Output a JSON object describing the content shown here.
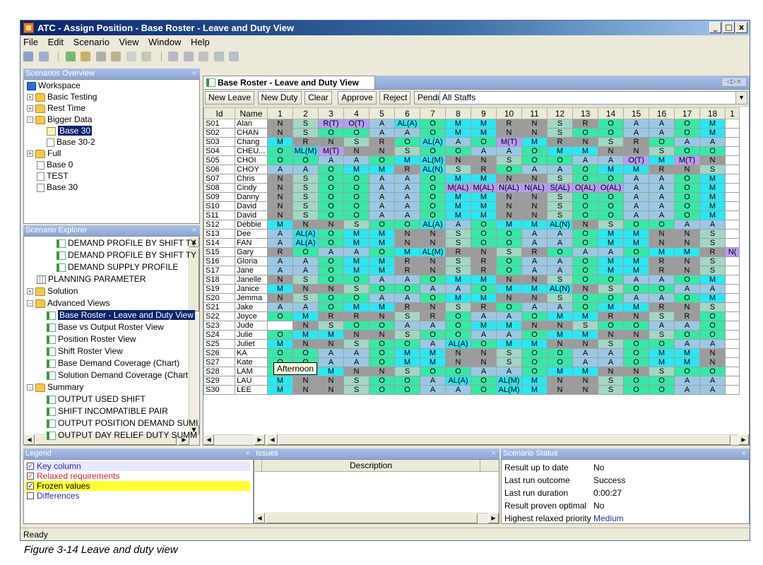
{
  "window": {
    "title": "ATC - Assign Position - Base Roster - Leave and Duty View",
    "controls": [
      "_",
      "□",
      "x"
    ]
  },
  "menu": [
    "File",
    "Edit",
    "Scenario",
    "View",
    "Window",
    "Help"
  ],
  "scenarios_overview": {
    "title": "Scenarios Overview",
    "tree": [
      {
        "label": "Workspace",
        "icon": "workspace-icon",
        "level": 0,
        "toggle": ""
      },
      {
        "label": "Basic Testing",
        "icon": "folder-icon",
        "level": 0,
        "toggle": "+"
      },
      {
        "label": "Rest Time",
        "icon": "folder-icon",
        "level": 0,
        "toggle": "+"
      },
      {
        "label": "Bigger Data",
        "icon": "folder-icon",
        "level": 0,
        "toggle": "-"
      },
      {
        "label": "Base 30",
        "icon": "scenario-icon",
        "level": 2,
        "toggle": "",
        "selected": true
      },
      {
        "label": "Base 30-2",
        "icon": "page-icon",
        "level": 2,
        "toggle": ""
      },
      {
        "label": "Full",
        "icon": "folder-icon",
        "level": 0,
        "toggle": "+"
      },
      {
        "label": "Base 0",
        "icon": "page-icon",
        "level": 1,
        "toggle": ""
      },
      {
        "label": "TEST",
        "icon": "page-icon",
        "level": 1,
        "toggle": ""
      },
      {
        "label": "Base 30",
        "icon": "page-icon",
        "level": 1,
        "toggle": ""
      }
    ]
  },
  "scenario_explorer": {
    "title": "Scenario Explorer",
    "tree": [
      {
        "label": "DEMAND PROFILE BY SHIFT TY",
        "icon": "view-icon",
        "level": 3,
        "toggle": ""
      },
      {
        "label": "DEMAND PROFILE BY SHIFT TY",
        "icon": "view-icon",
        "level": 3,
        "toggle": ""
      },
      {
        "label": "DEMAND SUPPLY PROFILE",
        "icon": "view-icon",
        "level": 3,
        "toggle": ""
      },
      {
        "label": "PLANNING PARAMETER",
        "icon": "table-icon",
        "level": 1,
        "toggle": ""
      },
      {
        "label": "Solution",
        "icon": "folder-icon",
        "level": 0,
        "toggle": "+"
      },
      {
        "label": "Advanced Views",
        "icon": "folder-icon",
        "level": 0,
        "toggle": "-"
      },
      {
        "label": "Base Roster - Leave and Duty View",
        "icon": "view-icon",
        "level": 2,
        "toggle": "",
        "selected": true
      },
      {
        "label": "Base vs Output Roster View",
        "icon": "view-icon",
        "level": 2,
        "toggle": ""
      },
      {
        "label": "Position Roster View",
        "icon": "view-icon",
        "level": 2,
        "toggle": ""
      },
      {
        "label": "Shift Roster View",
        "icon": "view-icon",
        "level": 2,
        "toggle": ""
      },
      {
        "label": "Base Demand Coverage (Chart)",
        "icon": "view-icon",
        "level": 2,
        "toggle": ""
      },
      {
        "label": "Solution Demand Coverage (Chart",
        "icon": "view-icon",
        "level": 2,
        "toggle": ""
      },
      {
        "label": "Summary",
        "icon": "folder-icon",
        "level": 0,
        "toggle": "-"
      },
      {
        "label": "OUTPUT USED SHIFT",
        "icon": "view-icon",
        "level": 2,
        "toggle": ""
      },
      {
        "label": "SHIFT INCOMPATIBLE PAIR",
        "icon": "view-icon",
        "level": 2,
        "toggle": ""
      },
      {
        "label": "OUTPUT POSITION DEMAND SUMI",
        "icon": "view-icon",
        "level": 2,
        "toggle": ""
      },
      {
        "label": "OUTPUT DAY RELIEF DUTY SUMM",
        "icon": "view-icon",
        "level": 2,
        "toggle": ""
      }
    ]
  },
  "editor": {
    "tab_title": "Base Roster - Leave and Duty View",
    "buttons": [
      "New Leave",
      "New Duty",
      "Clear",
      "Approve",
      "Reject",
      "Pending"
    ],
    "staff_filter": "All Staffs",
    "col_id": "Id",
    "col_name": "Name",
    "day_headers": [
      "1",
      "2",
      "3",
      "4",
      "5",
      "6",
      "7",
      "8",
      "9",
      "10",
      "11",
      "12",
      "13",
      "14",
      "15",
      "16",
      "17",
      "18",
      "1"
    ],
    "rows": [
      {
        "id": "S01",
        "name": "Alan",
        "cells": [
          "N",
          "S",
          "R(T)",
          "O(T)",
          "A",
          "AL(A)",
          "O",
          "M",
          "M",
          "R",
          "N",
          "S",
          "R",
          "O",
          "A",
          "A",
          "O",
          "M",
          ""
        ]
      },
      {
        "id": "S02",
        "name": "CHAN",
        "cells": [
          "N",
          "S",
          "O",
          "O",
          "A",
          "A",
          "O",
          "M",
          "M",
          "N",
          "N",
          "S",
          "O",
          "O",
          "A",
          "A",
          "O",
          "M",
          ""
        ]
      },
      {
        "id": "S03",
        "name": "Chang",
        "cells": [
          "M",
          "R",
          "N",
          "S",
          "R",
          "O",
          "AL(A)",
          "A",
          "O",
          "M(T)",
          "M",
          "R",
          "N",
          "S",
          "R",
          "O",
          "A",
          "A",
          ""
        ]
      },
      {
        "id": "S04",
        "name": "CHEU...",
        "cells": [
          "O",
          "ML(M)",
          "M(T)",
          "N",
          "N",
          "S",
          "O",
          "O",
          "A",
          "A",
          "O",
          "M",
          "M",
          "N",
          "N",
          "S",
          "O",
          "O",
          ""
        ]
      },
      {
        "id": "S05",
        "name": "CHOI",
        "cells": [
          "O",
          "O",
          "A",
          "A",
          "O",
          "M",
          "AL(M)",
          "N",
          "N",
          "S",
          "O",
          "O",
          "A",
          "A",
          "O(T)",
          "M",
          "M(T)",
          "N",
          ""
        ]
      },
      {
        "id": "S06",
        "name": "CHOY",
        "cells": [
          "A",
          "A",
          "O",
          "M",
          "M",
          "R",
          "AL(N)",
          "S",
          "R",
          "O",
          "A",
          "A",
          "O",
          "M",
          "M",
          "R",
          "N",
          "S",
          ""
        ]
      },
      {
        "id": "S07",
        "name": "Chris",
        "cells": [
          "N",
          "S",
          "O",
          "O",
          "A",
          "A",
          "O",
          "M",
          "M",
          "N",
          "N",
          "S",
          "O",
          "O",
          "A",
          "A",
          "O",
          "M",
          ""
        ]
      },
      {
        "id": "S08",
        "name": "Cindy",
        "cells": [
          "N",
          "S",
          "O",
          "O",
          "A",
          "A",
          "O",
          "M(AL)",
          "M(AL)",
          "N(AL)",
          "N(AL)",
          "S(AL)",
          "O(AL)",
          "O(AL)",
          "A",
          "A",
          "O",
          "M",
          ""
        ]
      },
      {
        "id": "S09",
        "name": "Danny",
        "cells": [
          "N",
          "S",
          "O",
          "O",
          "A",
          "A",
          "O",
          "M",
          "M",
          "N",
          "N",
          "S",
          "O",
          "O",
          "A",
          "A",
          "O",
          "M",
          ""
        ]
      },
      {
        "id": "S10",
        "name": "David",
        "cells": [
          "N",
          "S",
          "O",
          "O",
          "A",
          "A",
          "O",
          "M",
          "M",
          "N",
          "N",
          "S",
          "O",
          "O",
          "A",
          "A",
          "O",
          "M",
          ""
        ]
      },
      {
        "id": "S11",
        "name": "David",
        "cells": [
          "N",
          "S",
          "O",
          "O",
          "A",
          "A",
          "O",
          "M",
          "M",
          "N",
          "N",
          "S",
          "O",
          "O",
          "A",
          "A",
          "O",
          "M",
          ""
        ]
      },
      {
        "id": "S12",
        "name": "Debbie",
        "cells": [
          "M",
          "N",
          "N",
          "S",
          "O",
          "O",
          "AL(A)",
          "A",
          "O",
          "M",
          "M",
          "AL(N)",
          "N",
          "S",
          "O",
          "O",
          "A",
          "A",
          ""
        ]
      },
      {
        "id": "S13",
        "name": "Dee",
        "cells": [
          "A",
          "AL(A)",
          "O",
          "M",
          "M",
          "N",
          "N",
          "S",
          "O",
          "O",
          "A",
          "A",
          "O",
          "M",
          "M",
          "N",
          "N",
          "S",
          ""
        ]
      },
      {
        "id": "S14",
        "name": "FAN",
        "cells": [
          "A",
          "AL(A)",
          "O",
          "M",
          "M",
          "N",
          "N",
          "S",
          "O",
          "O",
          "A",
          "A",
          "O",
          "M",
          "M",
          "N",
          "N",
          "S",
          ""
        ]
      },
      {
        "id": "S15",
        "name": "Gary",
        "cells": [
          "R",
          "O",
          "A",
          "A",
          "O",
          "M",
          "AL(M)",
          "R",
          "N",
          "S",
          "R",
          "O",
          "A",
          "A",
          "O",
          "M",
          "M",
          "R",
          "N("
        ]
      },
      {
        "id": "S16",
        "name": "Gloria",
        "cells": [
          "A",
          "A",
          "O",
          "M",
          "M",
          "R",
          "N",
          "S",
          "R",
          "O",
          "A",
          "A",
          "O",
          "M",
          "M",
          "R",
          "N",
          "S",
          ""
        ]
      },
      {
        "id": "S17",
        "name": "Jane",
        "cells": [
          "A",
          "A",
          "O",
          "M",
          "M",
          "R",
          "N",
          "S",
          "R",
          "O",
          "A",
          "A",
          "O",
          "M",
          "M",
          "R",
          "N",
          "S",
          ""
        ]
      },
      {
        "id": "S18",
        "name": "Janelle",
        "cells": [
          "N",
          "S",
          "O",
          "O",
          "A",
          "A",
          "O",
          "M",
          "M",
          "N",
          "N",
          "S",
          "O",
          "O",
          "A",
          "A",
          "O",
          "M",
          ""
        ]
      },
      {
        "id": "S19",
        "name": "Janice",
        "cells": [
          "M",
          "N",
          "N",
          "S",
          "O",
          "O",
          "A",
          "A",
          "O",
          "M",
          "M",
          "AL(N)",
          "N",
          "S",
          "O",
          "O",
          "A",
          "A",
          ""
        ]
      },
      {
        "id": "S20",
        "name": "Jemma",
        "cells": [
          "N",
          "S",
          "O",
          "O",
          "A",
          "A",
          "O",
          "M",
          "M",
          "N",
          "N",
          "S",
          "O",
          "O",
          "A",
          "A",
          "O",
          "M",
          ""
        ]
      },
      {
        "id": "S21",
        "name": "Jake",
        "cells": [
          "A",
          "A",
          "O",
          "M",
          "M",
          "R",
          "N",
          "S",
          "R",
          "O",
          "A",
          "A",
          "O",
          "M",
          "M",
          "R",
          "N",
          "S",
          ""
        ]
      },
      {
        "id": "S22",
        "name": "Joyce",
        "cells": [
          "O",
          "M",
          "R",
          "R",
          "N",
          "S",
          "R",
          "O",
          "A",
          "A",
          "O",
          "M",
          "M",
          "R",
          "N",
          "S",
          "R",
          "O",
          ""
        ]
      },
      {
        "id": "S23",
        "name": "Jude",
        "cells": [
          "",
          "N",
          "S",
          "O",
          "O",
          "A",
          "A",
          "O",
          "M",
          "M",
          "N",
          "N",
          "S",
          "O",
          "O",
          "A",
          "A",
          "O",
          ""
        ]
      },
      {
        "id": "S24",
        "name": "Julie",
        "cells": [
          "O",
          "M",
          "M",
          "N",
          "N",
          "S",
          "O",
          "O",
          "A",
          "A",
          "O",
          "M",
          "M",
          "N",
          "N",
          "S",
          "O",
          "O",
          ""
        ]
      },
      {
        "id": "S25",
        "name": "Juliet",
        "cells": [
          "M",
          "N",
          "N",
          "S",
          "O",
          "O",
          "A",
          "AL(A)",
          "O",
          "M",
          "M",
          "N",
          "N",
          "S",
          "O",
          "O",
          "A",
          "A",
          ""
        ]
      },
      {
        "id": "S26",
        "name": "KA",
        "cells": [
          "O",
          "O",
          "A",
          "A",
          "O",
          "M",
          "M",
          "N",
          "N",
          "S",
          "O",
          "O",
          "A",
          "A",
          "O",
          "M",
          "M",
          "N",
          ""
        ]
      },
      {
        "id": "S27",
        "name": "Kate",
        "cells": [
          "O",
          "O",
          "A",
          "A",
          "O",
          "M",
          "M",
          "N",
          "N",
          "S",
          "O",
          "O",
          "A",
          "A",
          "O",
          "M",
          "M",
          "N",
          ""
        ]
      },
      {
        "id": "S28",
        "name": "LAM",
        "cells": [
          "O",
          "M",
          "M",
          "N",
          "N",
          "S",
          "O",
          "O",
          "A",
          "A",
          "O",
          "M",
          "M",
          "N",
          "N",
          "S",
          "O",
          "O",
          ""
        ]
      },
      {
        "id": "S29",
        "name": "LAU",
        "cells": [
          "M",
          "N",
          "N",
          "S",
          "O",
          "O",
          "A",
          "AL(A)",
          "O",
          "AL(M)",
          "M",
          "N",
          "N",
          "S",
          "O",
          "O",
          "A",
          "A",
          ""
        ]
      },
      {
        "id": "S30",
        "name": "LEE",
        "cells": [
          "M",
          "N",
          "N",
          "S",
          "O",
          "O",
          "A",
          "A",
          "O",
          "AL(M)",
          "M",
          "N",
          "N",
          "S",
          "O",
          "O",
          "A",
          "A",
          ""
        ]
      }
    ],
    "tooltip": "Afternoon"
  },
  "shift_colors": {
    "N": "#9c9c9c",
    "S": "#a3d6c4",
    "O": "#37e8a6",
    "A": "#9ac8e4",
    "M": "#2ce6f2",
    "R": "#9c9c9c",
    "leave": "#b79cf6",
    "special": "#2ce6f2",
    "key": "#ffffff"
  },
  "legend": {
    "title": "Legend",
    "items": [
      {
        "label": "Key column",
        "checked": true,
        "color": "#2a2ab0",
        "bg": "#e8e8ff"
      },
      {
        "label": "Relaxed requirements",
        "checked": true,
        "color": "#e0202a",
        "bg": "#ffffff"
      },
      {
        "label": "Frozen values",
        "checked": true,
        "color": "#000000",
        "bg": "#ffff33"
      },
      {
        "label": "Differences",
        "checked": false,
        "color": "#2a2ab0",
        "bg": "#ffffff"
      }
    ]
  },
  "issues": {
    "title": "Issues",
    "col": "Description"
  },
  "scenario_status": {
    "title": "Scenario Status",
    "rows": [
      {
        "label": "Result up to date",
        "value": "No"
      },
      {
        "label": "Last run outcome",
        "value": "Success"
      },
      {
        "label": "Last run duration",
        "value": "0:00:27"
      },
      {
        "label": "Result proven optimal",
        "value": "No"
      },
      {
        "label": "Highest relaxed priority",
        "value": "Medium"
      }
    ]
  },
  "status_bar": "Ready",
  "caption": "Figure 3-14   Leave and duty view"
}
